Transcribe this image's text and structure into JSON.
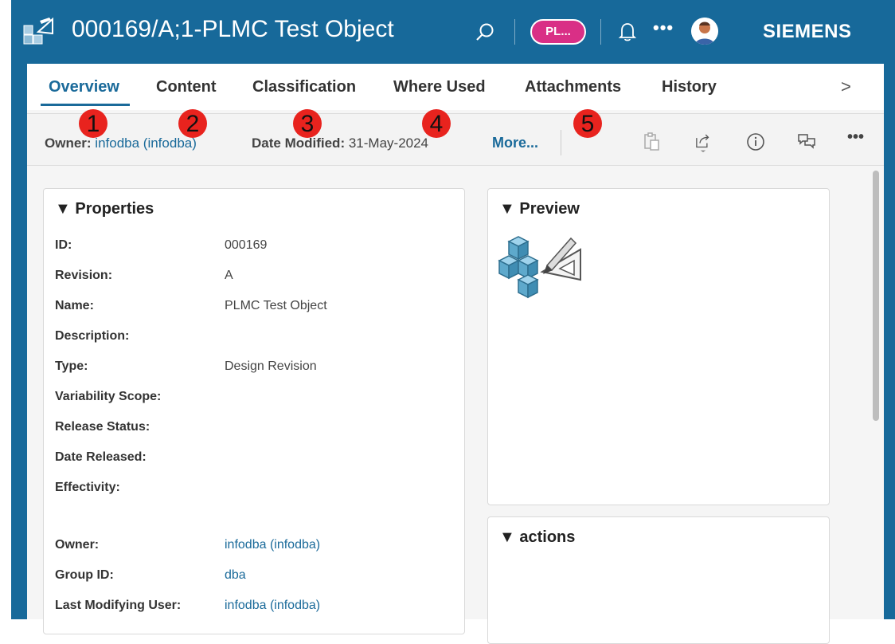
{
  "header": {
    "title": "000169/A;1-PLMC Test Object",
    "pill_label": "PL...",
    "more_label": "•••",
    "brand": "SIEMENS",
    "icons": [
      "item-revision-icon",
      "search-icon",
      "bell-icon",
      "more-icon",
      "avatar"
    ]
  },
  "tabs": {
    "items": [
      "Overview",
      "Content",
      "Classification",
      "Where Used",
      "Attachments",
      "History"
    ],
    "active": "Overview",
    "next_label": ">"
  },
  "infobar": {
    "owner_label": "Owner:",
    "owner_value": "infodba (infodba)",
    "date_label": "Date Modified:",
    "date_value": "31-May-2024",
    "more_label": "More...",
    "icons": [
      "paste-icon",
      "share-icon",
      "info-icon",
      "comments-icon",
      "overflow-icon"
    ],
    "overflow_label": "•••"
  },
  "badges": [
    "1",
    "2",
    "3",
    "4",
    "5"
  ],
  "properties": {
    "title": "▼ Properties",
    "rows": [
      {
        "label": "ID:",
        "value": "000169"
      },
      {
        "label": "Revision:",
        "value": "A"
      },
      {
        "label": "Name:",
        "value": "PLMC Test Object"
      },
      {
        "label": "Description:",
        "value": ""
      },
      {
        "label": "Type:",
        "value": "Design Revision"
      },
      {
        "label": "Variability Scope:",
        "value": ""
      },
      {
        "label": "Release Status:",
        "value": ""
      },
      {
        "label": "Date Released:",
        "value": ""
      },
      {
        "label": "Effectivity:",
        "value": ""
      }
    ],
    "owner_rows": [
      {
        "label": "Owner:",
        "value": "infodba (infodba)"
      },
      {
        "label": "Group ID:",
        "value": "dba"
      },
      {
        "label": "Last Modifying User:",
        "value": "infodba (infodba)"
      }
    ]
  },
  "preview": {
    "title": "▼ Preview"
  },
  "actions": {
    "title": "▼ actions"
  },
  "colors": {
    "header": "#17699a",
    "accent": "#1a6a9a",
    "pill": "#d92f86",
    "badge": "#e8231e"
  }
}
